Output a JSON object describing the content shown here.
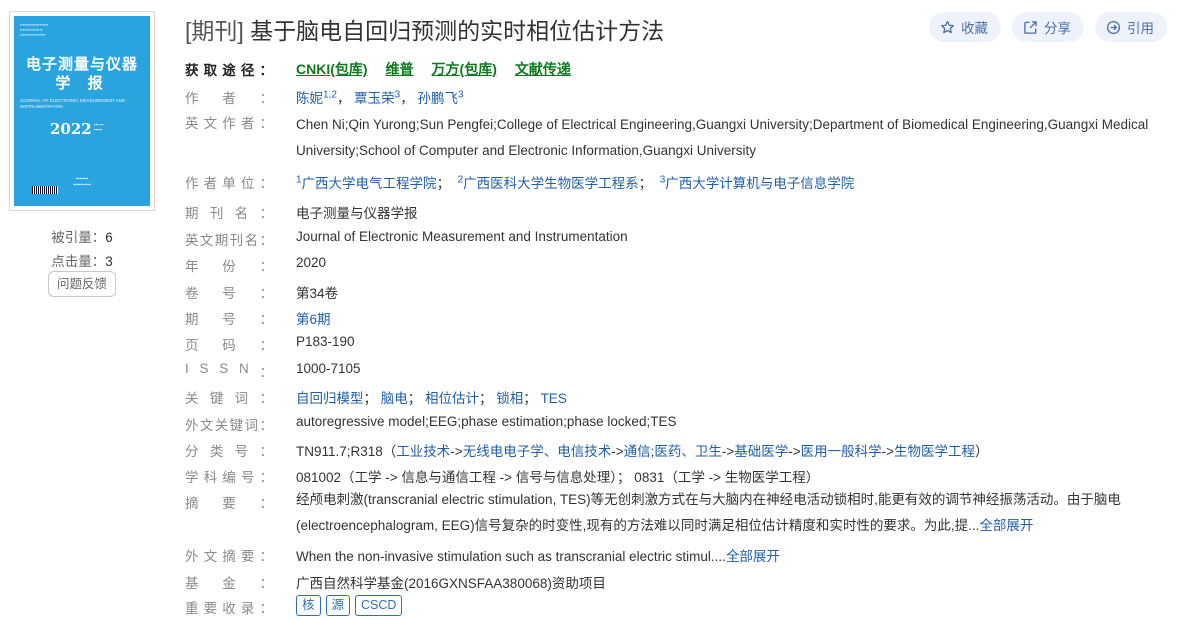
{
  "cover": {
    "title_line1": "电子测量与仪器",
    "title_line2": "学 报",
    "en_line": "JOURNAL OF ELECTRONIC MEASUREMENT AND INSTRUMENTATION",
    "year": "2022",
    "color": "#2aa4de"
  },
  "stats": {
    "cited_label": "被引量：",
    "cited_value": "6",
    "clicks_label": "点击量：",
    "clicks_value": "3",
    "feedback": "问题反馈"
  },
  "article": {
    "tag": "[期刊]",
    "title": "基于脑电自回归预测的实时相位估计方法"
  },
  "actions": [
    {
      "label": "收藏",
      "icon": "star-icon"
    },
    {
      "label": "分享",
      "icon": "share-icon"
    },
    {
      "label": "引用",
      "icon": "cite-icon"
    }
  ],
  "access": {
    "label": "获取途径：",
    "links": [
      "CNKI(包库)",
      "维普",
      "万方(包库)",
      "文献传递"
    ]
  },
  "fields": {
    "authors": {
      "label": "作者：",
      "items": [
        {
          "name": "陈妮",
          "sup": "1,2"
        },
        {
          "name": "覃玉荣",
          "sup": "3"
        },
        {
          "name": "孙鹏飞",
          "sup": "3"
        }
      ]
    },
    "en_authors": {
      "label": "英文作者：",
      "value": "Chen Ni;Qin Yurong;Sun Pengfei;College of Electrical Engineering,Guangxi University;Department of Biomedical Engineering,Guangxi Medical University;School of Computer and Electronic Information,Guangxi University"
    },
    "units": {
      "label": "作者单位：",
      "items": [
        {
          "sup": "1",
          "name": "广西大学电气工程学院"
        },
        {
          "sup": "2",
          "name": "广西医科大学生物医学工程系"
        },
        {
          "sup": "3",
          "name": "广西大学计算机与电子信息学院"
        }
      ]
    },
    "journal": {
      "label": "期刊名：",
      "value": "电子测量与仪器学报"
    },
    "en_journal": {
      "label": "英文期刊名：",
      "value": "Journal of Electronic Measurement and Instrumentation"
    },
    "year": {
      "label": "年份：",
      "value": "2020"
    },
    "volume": {
      "label": "卷号：",
      "value": "第34卷"
    },
    "issue": {
      "label": "期号：",
      "value": "第6期"
    },
    "pages": {
      "label": "页码：",
      "value": "P183-190"
    },
    "issn": {
      "label": "ISSN：",
      "value": "1000-7105"
    },
    "keywords": {
      "label": "关键词：",
      "items": [
        "自回归模型",
        "脑电",
        "相位估计",
        "锁相",
        "TES"
      ]
    },
    "en_keywords": {
      "label": "外文关键词：",
      "value": "autoregressive model;EEG;phase estimation;phase locked;TES"
    },
    "classification": {
      "label": "分类号：",
      "prefix": "TN911.7;R318（",
      "path": [
        "工业技术",
        "无线电电子学、电信技术",
        "通信",
        "医药、卫生",
        "基础医学",
        "医用一般科学",
        "生物医学工程"
      ],
      "suffix": "）"
    },
    "discipline": {
      "label": "学科编号：",
      "value": "081002（工学 -> 信息与通信工程 -> 信号与信息处理）； 0831（工学 -> 生物医学工程）"
    },
    "abstract": {
      "label": "摘要：",
      "value": "经颅电刺激(transcranial electric stimulation, TES)等无创刺激方式在与大脑内在神经电活动锁相时,能更有效的调节神经振荡活动。由于脑电(electroencephalogram, EEG)信号复杂的时变性,现有的方法难以同时满足相位估计精度和实时性的要求。为此,提...",
      "more": "全部展开"
    },
    "en_abstract": {
      "label": "外文摘要：",
      "value": "When the non-invasive stimulation such as transcranial electric stimul....",
      "more": "全部展开"
    },
    "fund": {
      "label": "基金：",
      "value": "广西自然科学基金(2016GXNSFAA380068)资助项目"
    },
    "indexed": {
      "label": "重要收录：",
      "items": [
        "核",
        "源",
        "CSCD"
      ]
    }
  }
}
